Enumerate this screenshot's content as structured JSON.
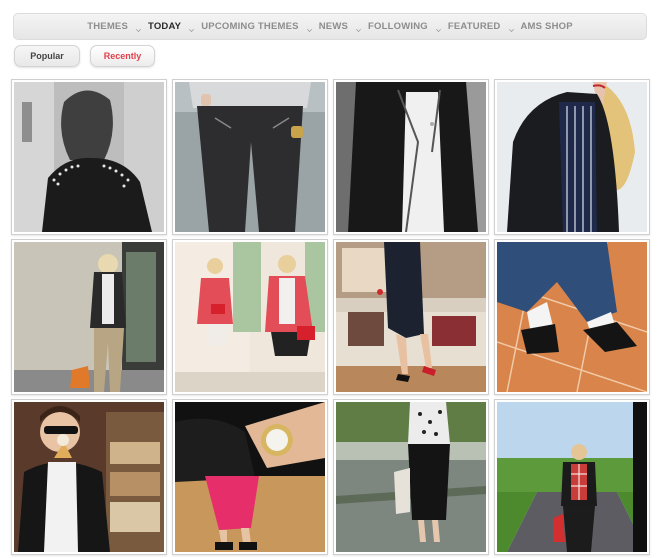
{
  "nav": {
    "items": [
      {
        "label": "THEMES",
        "active": false
      },
      {
        "label": "TODAY",
        "active": true
      },
      {
        "label": "UPCOMING THEMES",
        "active": false
      },
      {
        "label": "NEWS",
        "active": false
      },
      {
        "label": "FOLLOWING",
        "active": false
      },
      {
        "label": "FEATURED",
        "active": false
      },
      {
        "label": "AMS SHOP",
        "active": false
      }
    ]
  },
  "sort_toggles": {
    "popular_label": "Popular",
    "recent_label": "Recently"
  },
  "colors": {
    "accent_red": "#e0404b",
    "nav_active": "#2a2a2a",
    "nav_inactive": "#8d8d8d"
  },
  "photos": [
    {
      "name": "photo-studded-leather-jacket-bw"
    },
    {
      "name": "photo-leather-trousers"
    },
    {
      "name": "photo-biker-jacket-white-tee-bw"
    },
    {
      "name": "photo-leather-jacket-striped-top"
    },
    {
      "name": "photo-leather-jacket-khaki-trousers"
    },
    {
      "name": "photo-red-blazer-mirror"
    },
    {
      "name": "photo-black-pencil-skirt-red-heels"
    },
    {
      "name": "photo-jeans-black-ankle-boots"
    },
    {
      "name": "photo-ice-cream-leather-jacket"
    },
    {
      "name": "photo-gold-watch-pink-trousers"
    },
    {
      "name": "photo-black-midi-skirt-lace-top"
    },
    {
      "name": "photo-leather-jacket-plaid-shirt-road"
    }
  ]
}
